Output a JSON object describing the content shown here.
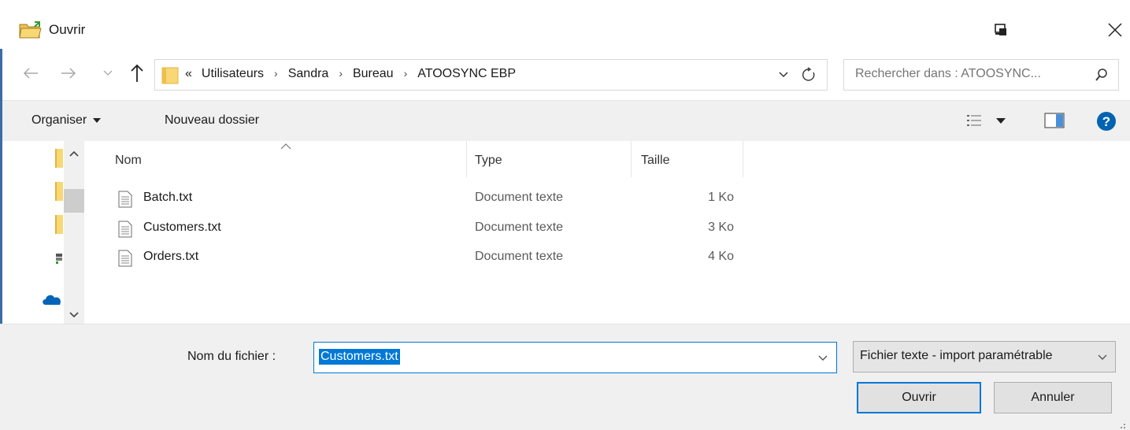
{
  "window": {
    "title": "Ouvrir"
  },
  "address_bar": {
    "overflow_marker": "«",
    "breadcrumbs": [
      "Utilisateurs",
      "Sandra",
      "Bureau",
      "ATOOSYNC EBP"
    ],
    "separator": "›"
  },
  "search": {
    "placeholder": "Rechercher dans : ATOOSYNC..."
  },
  "toolbar": {
    "organise_label": "Organiser",
    "new_folder_label": "Nouveau dossier"
  },
  "columns": {
    "name": "Nom",
    "type": "Type",
    "size": "Taille"
  },
  "files": [
    {
      "name": "Batch.txt",
      "type": "Document texte",
      "size": "1 Ko"
    },
    {
      "name": "Customers.txt",
      "type": "Document texte",
      "size": "3 Ko"
    },
    {
      "name": "Orders.txt",
      "type": "Document texte",
      "size": "4 Ko"
    }
  ],
  "footer": {
    "filename_label": "Nom du fichier :",
    "filename_value": "Customers.txt",
    "filetype_value": "Fichier texte - import paramétrable",
    "open_label": "Ouvrir",
    "cancel_label": "Annuler"
  },
  "colors": {
    "accent": "#0078d7",
    "folder": "#f8d775",
    "help": "#0063b1"
  }
}
